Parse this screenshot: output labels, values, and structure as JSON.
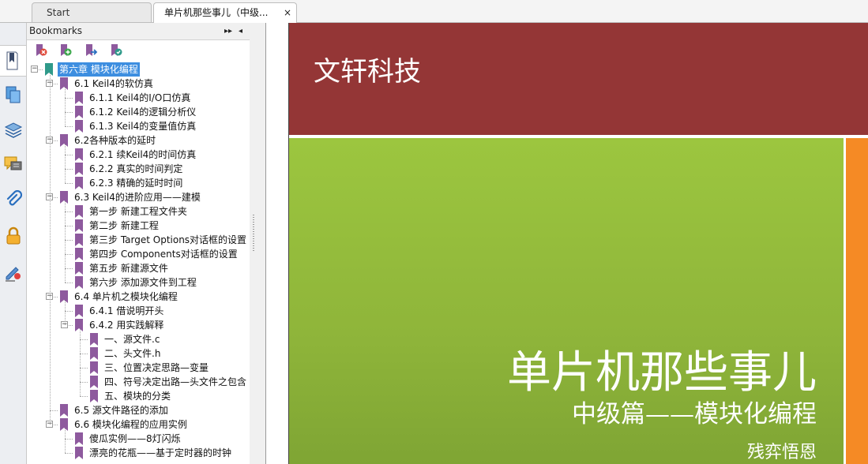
{
  "tabs": [
    {
      "label": "Start"
    },
    {
      "label": "单片机那些事儿（中级...",
      "close": "×"
    }
  ],
  "panel": {
    "title": "Bookmarks",
    "expand_glyph": "▸▸",
    "collapse_glyph": "◂"
  },
  "colors": {
    "banner": "#943636",
    "green": "#9cc63f",
    "orange": "#f58a25",
    "bookmark": "#8e5a9e",
    "selection": "#3d8ee0"
  },
  "left_icons": [
    "bookmarks-icon",
    "pages-icon",
    "layers-icon",
    "comments-icon",
    "attachments-icon",
    "security-icon",
    "signatures-icon"
  ],
  "toolbar_icons": [
    "delete-bookmark-icon",
    "add-bookmark-icon",
    "move-bookmark-icon",
    "bookmark-properties-icon"
  ],
  "bookmarks": [
    {
      "label": "第六章  模块化编程",
      "level": 0,
      "expanded": true,
      "selected": true
    },
    {
      "label": "6.1 Keil4的软仿真",
      "level": 1,
      "expanded": true
    },
    {
      "label": "6.1.1 Keil4的I/O口仿真",
      "level": 2
    },
    {
      "label": "6.1.2 Keil4的逻辑分析仪",
      "level": 2
    },
    {
      "label": "6.1.3 Keil4的变量值仿真",
      "level": 2
    },
    {
      "label": "6.2各种版本的延时",
      "level": 1,
      "expanded": true
    },
    {
      "label": "6.2.1 续Keil4的时间仿真",
      "level": 2
    },
    {
      "label": "6.2.2 真实的时间判定",
      "level": 2
    },
    {
      "label": "6.2.3 精确的延时时间",
      "level": 2
    },
    {
      "label": "6.3 Keil4的进阶应用——建模",
      "level": 1,
      "expanded": true
    },
    {
      "label": "第一步 新建工程文件夹",
      "level": 2
    },
    {
      "label": "第二步 新建工程",
      "level": 2
    },
    {
      "label": "第三步 Target Options对话框的设置",
      "level": 2
    },
    {
      "label": "第四步 Components对话框的设置",
      "level": 2
    },
    {
      "label": "第五步 新建源文件",
      "level": 2
    },
    {
      "label": "第六步 添加源文件到工程",
      "level": 2
    },
    {
      "label": "6.4 单片机之模块化编程",
      "level": 1,
      "expanded": true
    },
    {
      "label": "6.4.1 借说明开头",
      "level": 2
    },
    {
      "label": "6.4.2 用实践解释",
      "level": 2,
      "expanded": true
    },
    {
      "label": "一、源文件.c",
      "level": 3
    },
    {
      "label": "二、头文件.h",
      "level": 3
    },
    {
      "label": "三、位置决定思路—变量",
      "level": 3
    },
    {
      "label": "四、符号决定出路—头文件之包含",
      "level": 3
    },
    {
      "label": "五、模块的分类",
      "level": 3
    },
    {
      "label": "6.5 源文件路径的添加",
      "level": 1
    },
    {
      "label": "6.6 模块化编程的应用实例",
      "level": 1,
      "expanded": true
    },
    {
      "label": "傻瓜实例——8灯闪烁",
      "level": 2
    },
    {
      "label": "漂亮的花瓶——基于定时器的时钟",
      "level": 2
    }
  ],
  "document": {
    "company": "文轩科技",
    "title": "单片机那些事儿",
    "subtitle": "中级篇——模块化编程",
    "author": "残弈悟恩"
  }
}
